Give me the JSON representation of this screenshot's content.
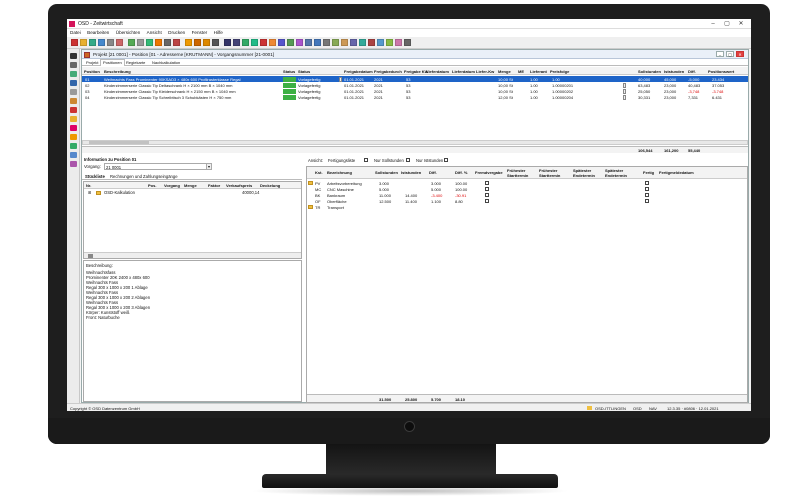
{
  "window": {
    "app_title": "OSD - Zeitwirtschaft"
  },
  "menu": [
    "Datei",
    "Bearbeiten",
    "Übersichten",
    "Ansicht",
    "Drucken",
    "Fenster",
    "Hilfe"
  ],
  "project_window": {
    "title": "Projekt [21 0001] - Position [01 - Adresserne [KRUTMANN] - Vorgangsnummer [21-0001]",
    "tabs": [
      "Projekt",
      "Positionen",
      "Regiekarte",
      "Nachkalkulation"
    ]
  },
  "positions_grid": {
    "headers": [
      "Position",
      "Beschreibung",
      "Status",
      "Status",
      "Freigabedatum",
      "Freigabedurch",
      "Freigabe KW",
      "Lieferdatum",
      "Lieferdatum",
      "Liefer-Kw",
      "Menge",
      "ME",
      "Lieferant",
      "Preisfolge",
      "Sollstunden",
      "Iststunden",
      "Diff.",
      "Positionswert"
    ],
    "rows": [
      {
        "pos": "01",
        "desc": "Weihnachts Fass Prominenter 90KSAD3 × 480x 600 Profilrasterklasse Regal",
        "status": "Vorlagefertig",
        "date": "01.01.2021",
        "by": "2021",
        "kw": "53",
        "qty": "10,00 St",
        "lieferant": "1.00",
        "preis": "1.00",
        "soll": "40,000",
        "ist": "45,000",
        "diff": "-5,000",
        "wert": "23.434"
      },
      {
        "pos": "02",
        "desc": "Kinderzimmerserie Classic Tip Deltaschrank H × 2100 mm B × 1040 mm",
        "status": "Vorlagefertig",
        "date": "01.01.2021",
        "by": "2021",
        "kw": "53",
        "qty": "10,00 St",
        "lieferant": "1.00",
        "preis": "1.00000201",
        "soll": "63,483",
        "ist": "23,000",
        "diff": "40,483",
        "wert": "37.053"
      },
      {
        "pos": "03",
        "desc": "Kinderzimmerserie Classic Tip Kleiderschrank H × 2150 mm B × 1040 mm",
        "status": "Vorlagefertig",
        "date": "01.01.2021",
        "by": "2021",
        "kw": "53",
        "qty": "10,00 St",
        "lieferant": "1.00",
        "preis": "1.00000202",
        "soll": "25,050",
        "ist": "23,000",
        "diff": "-3,748",
        "wert": "-3.748"
      },
      {
        "pos": "04",
        "desc": "Kinderzimmerserie Classic Tip Schreibtisch 3 Schubkästen H × 750 mm",
        "status": "Vorlagefertig",
        "date": "01.01.2021",
        "by": "2021",
        "kw": "53",
        "qty": "12,00 St",
        "lieferant": "1.00",
        "preis": "1.00000204",
        "soll": "30,331",
        "ist": "23,000",
        "diff": "7,331",
        "wert": "6.431"
      }
    ],
    "totals": {
      "soll": "106,544",
      "ist": "161,200",
      "diff": "55,440"
    }
  },
  "info": {
    "title": "Information zu Position 01",
    "vorgang_label": "Vorgang:",
    "vorgang_value": "21 0001",
    "subtabs": [
      "Stückliste",
      "Rechnungen und Zahlungseingänge"
    ],
    "tree_headers": [
      "Nr.",
      "Pos.",
      "Vorgang",
      "Menge",
      "Faktor",
      "Verkaufspreis",
      "Deckelung"
    ],
    "tree_row": {
      "label": "OSD-Kalkulation",
      "value": "40000,14"
    },
    "desc_label": "Beschreibung:",
    "desc_lines": [
      "Weihnachtsfass",
      "Prominenter 20K 2400 x 480x 600",
      "Weihnachts Fass",
      "Regal 300 x 1000 x 200 1 Ablage",
      "Weihnachts Fass",
      "Regal 300 x 1000 x 200 2 Ablagen",
      "Weihnachts Fass",
      "Regal 300 x 1000 x 200 3 Ablagen",
      "Körper: Kunststoff weiß",
      "Front: Naturbuche"
    ]
  },
  "detail": {
    "ansicht_label": "Ansicht:",
    "filters": [
      "Fertigungsliste",
      "Nur Sollstunden",
      "Nur Iststunden"
    ],
    "headers": [
      "Kst.",
      "Bezeichnung",
      "Sollstunden",
      "Iststunden",
      "Diff.",
      "Diff. %",
      "Fremdvergabe",
      "Frühester Starttermin",
      "Frühester Starttermin",
      "Spätester Endetermin",
      "Spätester Endetermin",
      "Fertig",
      "Fertigmeldedatum"
    ],
    "rows": [
      {
        "kst": "PV",
        "name": "Arbeitsvorbereitung",
        "soll": "3.000",
        "ist": "",
        "diff": "3.000",
        "pct": "100.00"
      },
      {
        "kst": "MC",
        "name": "CNC Maschine",
        "soll": "5.000",
        "ist": "",
        "diff": "5.000",
        "pct": "100.00"
      },
      {
        "kst": "BK",
        "name": "Bankraum",
        "soll": "11.000",
        "ist": "14.400",
        "diff": "-3.400",
        "pct": "-30.91"
      },
      {
        "kst": "OF",
        "name": "Oberfläche",
        "soll": "12.500",
        "ist": "11.400",
        "diff": "1.100",
        "pct": "8.80"
      },
      {
        "kst": "TR",
        "name": "Transport",
        "soll": "",
        "ist": "",
        "diff": "",
        "pct": ""
      }
    ],
    "totals": {
      "soll": "31.500",
      "ist": "25.800",
      "diff": "5.700",
      "pct": "18.10"
    }
  },
  "status_bar": {
    "copyright": "Copyright © OSD Datenzentrum GmbH",
    "user": "OSD-ITTLINGEN",
    "items": [
      "OSD",
      "NAV"
    ],
    "version": "12.3.35 · #0806 · 12.01.2021"
  }
}
